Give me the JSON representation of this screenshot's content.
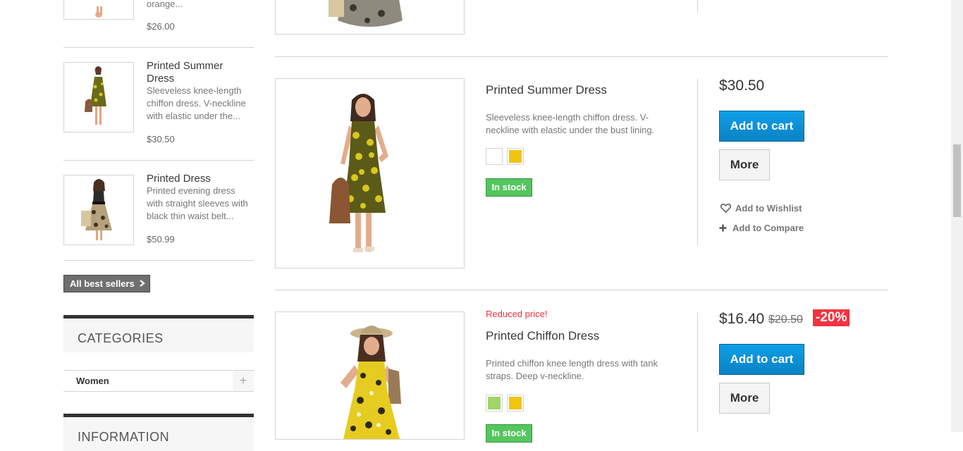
{
  "sidebar": {
    "best_sellers": [
      {
        "title": "",
        "desc": "orange...",
        "price": "$26.00"
      },
      {
        "title": "Printed Summer Dress",
        "desc": "Sleeveless knee-length chiffon dress. V-neckline with elastic under the...",
        "price": "$30.50"
      },
      {
        "title": "Printed Dress",
        "desc": "Printed evening dress with straight sleeves with black thin waist belt...",
        "price": "$50.99"
      }
    ],
    "all_best_sellers_label": "All best sellers",
    "categories_heading": "CATEGORIES",
    "categories": [
      {
        "label": "Women",
        "toggle": "+"
      }
    ],
    "information_heading": "INFORMATION"
  },
  "products": [
    {
      "name": "Printed Summer Dress",
      "desc": "Sleeveless knee-length chiffon dress. V-neckline with elastic under the bust lining.",
      "colors": [
        "#ffffff",
        "#f1c40f"
      ],
      "stock": "In stock",
      "price": "$30.50",
      "add_to_cart": "Add to cart",
      "more": "More",
      "wishlist": "Add to Wishlist",
      "compare": "Add to Compare"
    },
    {
      "badge": "Reduced price!",
      "name": "Printed Chiffon Dress",
      "desc": "Printed chiffon knee length dress with tank straps. Deep v-neckline.",
      "colors": [
        "#a0d468",
        "#f1c40f"
      ],
      "stock": "In stock",
      "price": "$16.40",
      "old_price": "$20.50",
      "discount": "-20%",
      "add_to_cart": "Add to cart",
      "more": "More"
    }
  ],
  "colors": {
    "accent_blue": "#0b8fd5",
    "stock_green": "#55c65e",
    "sale_red": "#f13340"
  }
}
